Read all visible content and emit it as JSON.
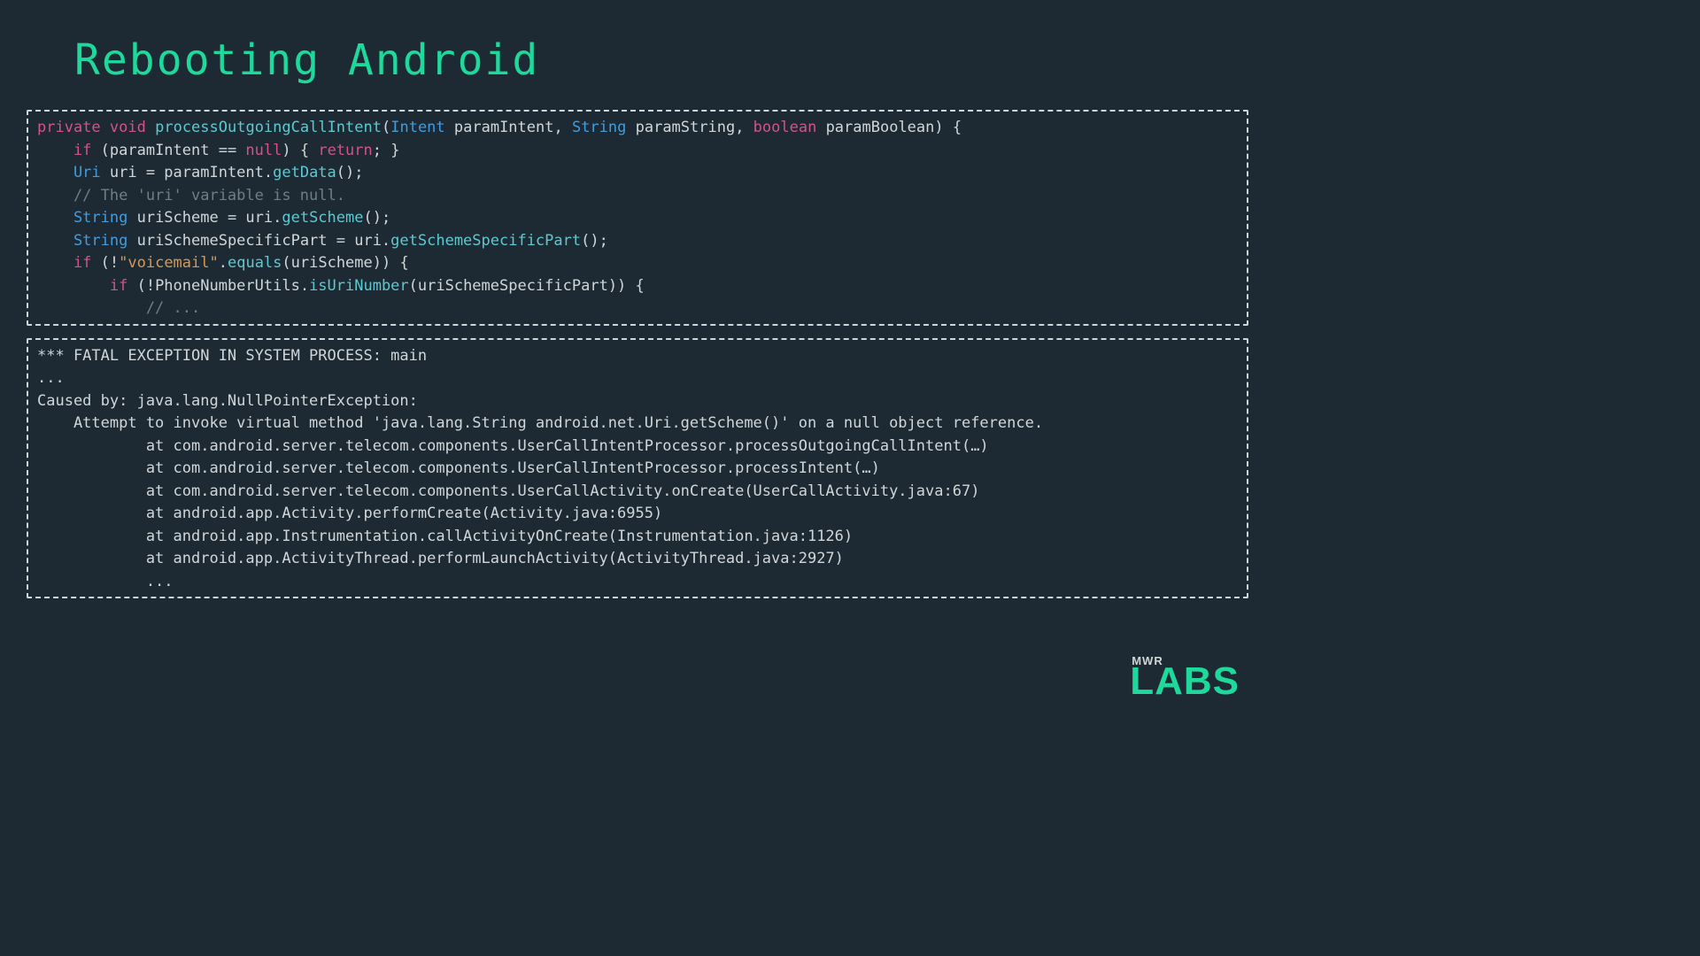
{
  "title": "Rebooting Android",
  "code_box_1": {
    "l1": {
      "a": "private",
      "b": "void",
      "c": "processOutgoingCallIntent",
      "d": "(",
      "e": "Intent",
      "f": " paramIntent, ",
      "g": "String",
      "h": " paramString, ",
      "i": "boolean",
      "j": " paramBoolean) {"
    },
    "l2": {
      "a": "    if",
      "b": " (paramIntent == ",
      "c": "null",
      "d": ") { ",
      "e": "return",
      "f": "; }"
    },
    "l3": {
      "a": "    Uri",
      "b": " uri = paramIntent.",
      "c": "getData",
      "d": "();"
    },
    "l4": "    // The 'uri' variable is null.",
    "l5": {
      "a": "    String",
      "b": " uriScheme = uri.",
      "c": "getScheme",
      "d": "();"
    },
    "l6": {
      "a": "    String",
      "b": " uriSchemeSpecificPart = uri.",
      "c": "getSchemeSpecificPart",
      "d": "();"
    },
    "l7": {
      "a": "    if",
      "b": " (!",
      "c": "\"voicemail\"",
      "d": ".",
      "e": "equals",
      "f": "(uriScheme)) {"
    },
    "l8": {
      "a": "        if",
      "b": " (!PhoneNumberUtils.",
      "c": "isUriNumber",
      "d": "(uriSchemeSpecificPart)) {"
    },
    "l9": "            // ..."
  },
  "code_box_2": {
    "l1": "*** FATAL EXCEPTION IN SYSTEM PROCESS: main",
    "l2": "...",
    "l3": "Caused by: java.lang.NullPointerException:",
    "l4": "    Attempt to invoke virtual method 'java.lang.String android.net.Uri.getScheme()' on a null object reference.",
    "l5": "            at com.android.server.telecom.components.UserCallIntentProcessor.processOutgoingCallIntent(…)",
    "l6": "            at com.android.server.telecom.components.UserCallIntentProcessor.processIntent(…)",
    "l7": "            at com.android.server.telecom.components.UserCallActivity.onCreate(UserCallActivity.java:67)",
    "l8": "            at android.app.Activity.performCreate(Activity.java:6955)",
    "l9": "            at android.app.Instrumentation.callActivityOnCreate(Instrumentation.java:1126)",
    "l10": "            at android.app.ActivityThread.performLaunchActivity(ActivityThread.java:2927)",
    "l11": "            ..."
  },
  "logo": {
    "top": "MWR",
    "bottom": "LABS"
  }
}
